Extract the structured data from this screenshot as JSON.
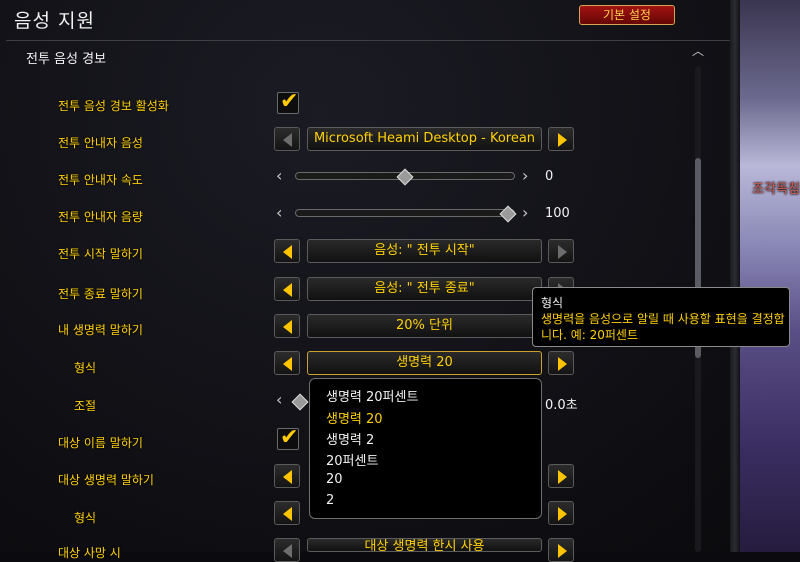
{
  "header": {
    "title": "음성 지원",
    "defaults_button": "기본 설정",
    "section_title": "전투 음성 경보"
  },
  "rows": {
    "enable": {
      "label": "전투 음성 경보 활성화",
      "checked": true
    },
    "voice": {
      "label": "전투 안내자 음성",
      "value": "Microsoft Heami Desktop - Korean"
    },
    "speed": {
      "label": "전투 안내자 속도",
      "value": "0",
      "level": 0.5
    },
    "volume": {
      "label": "전투 안내자 음량",
      "value": "100",
      "level": 1.0
    },
    "start": {
      "label": "전투 시작 말하기",
      "value": "음성: \" 전투 시작\""
    },
    "end": {
      "label": "전투 종료 말하기",
      "value": "음성: \" 전투 종료\""
    },
    "my_health": {
      "label": "내 생명력 말하기",
      "value": "20% 단위"
    },
    "format": {
      "label": "형식",
      "value": "생명력 20"
    },
    "adjust": {
      "label": "조절",
      "value": "0.0초"
    },
    "target_name": {
      "label": "대상 이름 말하기",
      "checked": true
    },
    "target_health": {
      "label": "대상 생명력 말하기"
    },
    "target_format": {
      "label": "형식"
    },
    "target_death": {
      "label": "대상 사망 시",
      "value": "대상 생명력 한시 사용"
    }
  },
  "dropdown_options": [
    {
      "text": "생명력 20퍼센트",
      "selected": false
    },
    {
      "text": "생명력 20",
      "selected": true
    },
    {
      "text": "생명력 2",
      "selected": false
    },
    {
      "text": "20퍼센트",
      "selected": false
    },
    {
      "text": "20",
      "selected": false
    },
    {
      "text": "2",
      "selected": false
    }
  ],
  "tooltip": {
    "title": "형식",
    "body": "생명력을 음성으로 알릴 때 사용할 표현을 결정합니다. 예: 20퍼센트"
  },
  "world": {
    "nameplate": "조각독침"
  },
  "colors": {
    "label": "#ffd100",
    "accent_button": "#a31212",
    "text": "#f2f2f2"
  }
}
